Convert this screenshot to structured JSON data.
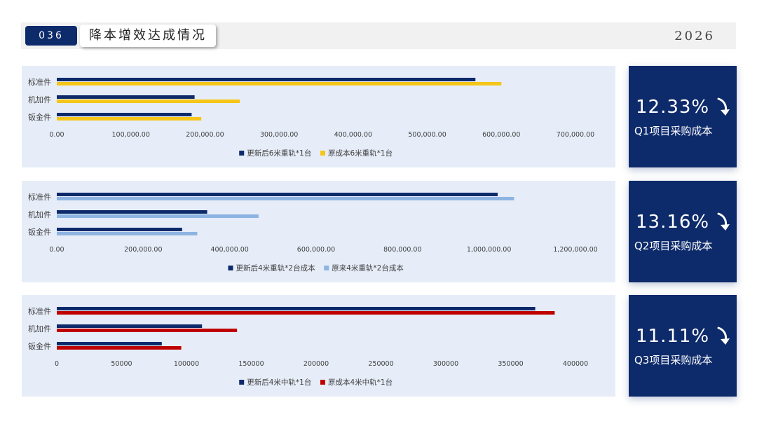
{
  "header": {
    "page_number": "036",
    "title": "降本增效达成情况",
    "year": "2026"
  },
  "colors": {
    "navy": "#0d2a6b",
    "gold": "#f5c518",
    "light_blue": "#8db4e2",
    "red": "#c00000",
    "panel_bg": "#e6edf8"
  },
  "cards": [
    {
      "value": "12.33%",
      "label": "Q1项目采购成本",
      "icon": "curved-arrow-down-icon"
    },
    {
      "value": "13.16%",
      "label": "Q2项目采购成本",
      "icon": "curved-arrow-down-icon"
    },
    {
      "value": "11.11%",
      "label": "Q3项目采购成本",
      "icon": "curved-arrow-down-icon"
    }
  ],
  "chart_data": [
    {
      "type": "bar",
      "orientation": "horizontal",
      "categories": [
        "标准件",
        "机加件",
        "钣金件"
      ],
      "series": [
        {
          "name": "更新后6米重轨*1台",
          "color": "#0d2a6b",
          "values": [
            565000,
            186000,
            182000
          ]
        },
        {
          "name": "原成本6米重轨*1台",
          "color": "#f5c518",
          "values": [
            600000,
            247000,
            195000
          ]
        }
      ],
      "xlim": [
        0,
        700000
      ],
      "xticks": [
        0,
        100000,
        200000,
        300000,
        400000,
        500000,
        600000,
        700000
      ],
      "xtick_labels": [
        "0.00",
        "100,000.00",
        "200,000.00",
        "300,000.00",
        "400,000.00",
        "500,000.00",
        "600,000.00",
        "700,000.00"
      ],
      "legend": "bottom"
    },
    {
      "type": "bar",
      "orientation": "horizontal",
      "categories": [
        "标准件",
        "机加件",
        "钣金件"
      ],
      "series": [
        {
          "name": "更新后4米重轨*2台成本",
          "color": "#0d2a6b",
          "values": [
            1020000,
            348000,
            290000
          ]
        },
        {
          "name": "原来4米重轨*2台成本",
          "color": "#8db4e2",
          "values": [
            1058000,
            467000,
            325000
          ]
        }
      ],
      "xlim": [
        0,
        1200000
      ],
      "xticks": [
        0,
        200000,
        400000,
        600000,
        800000,
        1000000,
        1200000
      ],
      "xtick_labels": [
        "0.00",
        "200,000.00",
        "400,000.00",
        "600,000.00",
        "800,000.00",
        "1,000,000.00",
        "1,200,000.00"
      ],
      "legend": "bottom"
    },
    {
      "type": "bar",
      "orientation": "horizontal",
      "categories": [
        "标准件",
        "机加件",
        "钣金件"
      ],
      "series": [
        {
          "name": "更新后4米中轨*1台",
          "color": "#0d2a6b",
          "values": [
            369000,
            112000,
            81000
          ]
        },
        {
          "name": "原成本4米中轨*1台",
          "color": "#c00000",
          "values": [
            384000,
            139000,
            96000
          ]
        }
      ],
      "xlim": [
        0,
        400000
      ],
      "xticks": [
        0,
        50000,
        100000,
        150000,
        200000,
        250000,
        300000,
        350000,
        400000
      ],
      "xtick_labels": [
        "0",
        "50000",
        "100000",
        "150000",
        "200000",
        "250000",
        "300000",
        "350000",
        "400000"
      ],
      "legend": "bottom"
    }
  ]
}
